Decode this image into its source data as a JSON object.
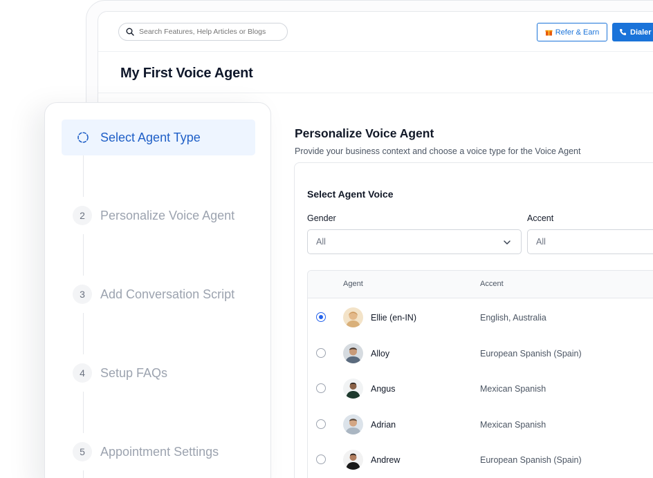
{
  "search": {
    "placeholder": "Search Features, Help Articles or Blogs"
  },
  "header": {
    "refer_label": "Refer & Earn",
    "dialer_label": "Dialer"
  },
  "page": {
    "title": "My First Voice Agent"
  },
  "section": {
    "title": "Personalize Voice Agent",
    "subtitle": "Provide your business context and choose a voice type for the Voice Agent"
  },
  "voice_card": {
    "title": "Select Agent Voice",
    "gender_label": "Gender",
    "accent_label": "Accent",
    "gender_value": "All",
    "accent_value": "All"
  },
  "table": {
    "headers": {
      "agent": "Agent",
      "accent": "Accent"
    },
    "rows": [
      {
        "name": "Ellie (en-IN)",
        "accent": "English, Australia",
        "selected": true
      },
      {
        "name": "Alloy",
        "accent": "European Spanish (Spain)",
        "selected": false
      },
      {
        "name": "Angus",
        "accent": "Mexican Spanish",
        "selected": false
      },
      {
        "name": "Adrian",
        "accent": "Mexican Spanish",
        "selected": false
      },
      {
        "name": "Andrew",
        "accent": "European Spanish (Spain)",
        "selected": false
      }
    ]
  },
  "steps": [
    {
      "label": "Select Agent Type",
      "active": true,
      "icon": "loading-spinner-icon"
    },
    {
      "num": "2",
      "label": "Personalize Voice Agent"
    },
    {
      "num": "3",
      "label": "Add Conversation Script"
    },
    {
      "num": "4",
      "label": "Setup FAQs"
    },
    {
      "num": "5",
      "label": "Appointment Settings"
    }
  ],
  "colors": {
    "accent": "#1a73d9",
    "active_step_bg": "#eef5ff",
    "active_step_text": "#1f5fc7"
  },
  "icons": {
    "search": "search-icon",
    "refer": "gift-icon",
    "dialer": "phone-icon",
    "select": "chevron-down-icon"
  }
}
